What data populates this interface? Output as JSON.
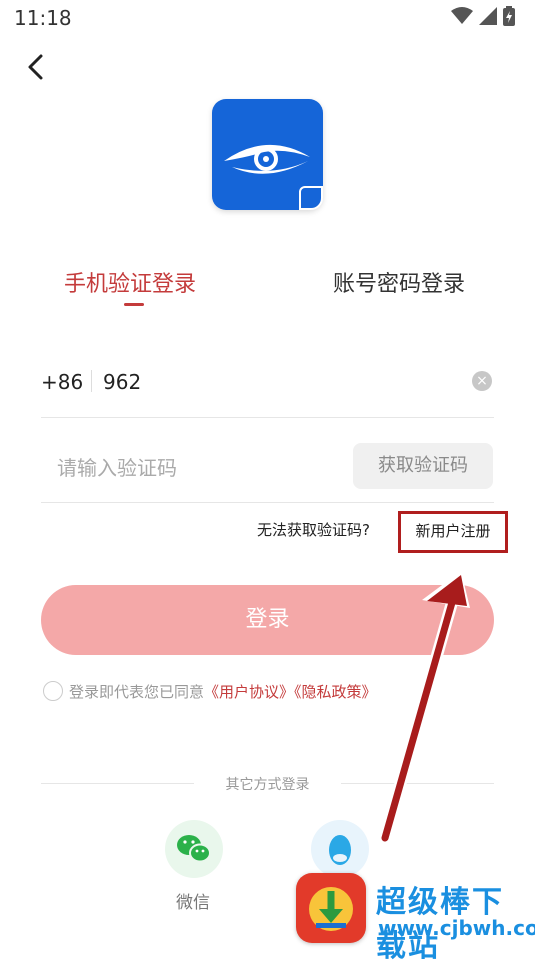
{
  "status_bar": {
    "time": "11:18",
    "icons": [
      "wifi-icon",
      "signal-icon",
      "battery-icon"
    ]
  },
  "header": {
    "back_icon": "chevron-left-icon",
    "app_logo_icon": "eye-logo-icon"
  },
  "tabs": [
    {
      "label": "手机验证登录",
      "active": true
    },
    {
      "label": "账号密码登录",
      "active": false
    }
  ],
  "phone": {
    "country_code": "+86",
    "value": "962",
    "clear_icon": "clear-icon"
  },
  "code": {
    "placeholder": "请输入验证码",
    "get_code_label": "获取验证码"
  },
  "links": {
    "no_code": "无法获取验证码?",
    "register": "新用户注册"
  },
  "login_button": "登录",
  "agreement": {
    "prefix": "登录即代表您已同意",
    "user_agreement": "《用户协议》",
    "privacy_policy": "《隐私政策》"
  },
  "other_login": {
    "label": "其它方式登录",
    "wechat_label": "微信",
    "wechat_icon": "wechat-icon",
    "qq_icon": "qq-icon"
  },
  "watermark": {
    "name": "超级棒下载站",
    "url": "www.cjbwh.com"
  },
  "colors": {
    "accent": "#c43b3b",
    "login_button": "#f4a8a8",
    "annotation": "#b01e1e",
    "watermark": "#1a8fe0"
  }
}
